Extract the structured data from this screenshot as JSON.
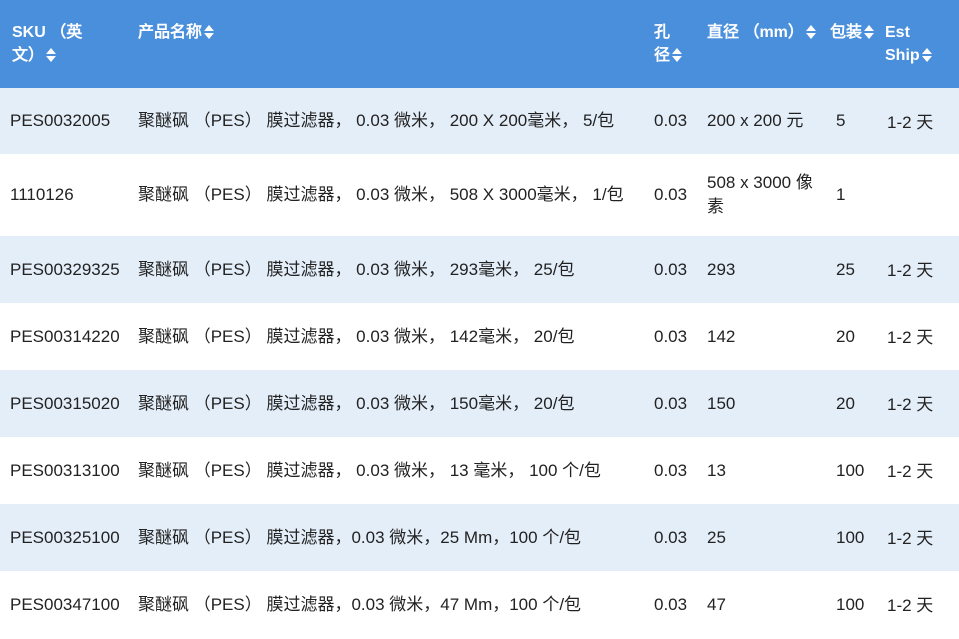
{
  "headers": {
    "sku": "SKU （英文）",
    "name": "产品名称",
    "pore": "孔径",
    "diameter": "直径 （mm）",
    "pack": "包装",
    "ship": "Est Ship"
  },
  "rows": [
    {
      "sku": "PES0032005",
      "name": "聚醚砜 （PES） 膜过滤器， 0.03 微米， 200 X 200毫米， 5/包",
      "pore": "0.03",
      "diameter": "200 x 200 元",
      "pack": "5",
      "ship": "1-2 天"
    },
    {
      "sku": "1110126",
      "name": "聚醚砜 （PES） 膜过滤器， 0.03 微米， 508 X 3000毫米， 1/包",
      "pore": "0.03",
      "diameter": "508 x 3000 像素",
      "pack": "1",
      "ship": ""
    },
    {
      "sku": "PES00329325",
      "name": "聚醚砜 （PES） 膜过滤器， 0.03 微米， 293毫米， 25/包",
      "pore": "0.03",
      "diameter": "293",
      "pack": "25",
      "ship": "1-2 天"
    },
    {
      "sku": "PES00314220",
      "name": "聚醚砜 （PES） 膜过滤器， 0.03 微米， 142毫米， 20/包",
      "pore": "0.03",
      "diameter": "142",
      "pack": "20",
      "ship": "1-2 天"
    },
    {
      "sku": "PES00315020",
      "name": "聚醚砜 （PES） 膜过滤器， 0.03 微米， 150毫米， 20/包",
      "pore": "0.03",
      "diameter": "150",
      "pack": "20",
      "ship": "1-2 天"
    },
    {
      "sku": "PES00313100",
      "name": "聚醚砜 （PES） 膜过滤器， 0.03 微米， 13 毫米， 100 个/包",
      "pore": "0.03",
      "diameter": "13",
      "pack": "100",
      "ship": "1-2 天"
    },
    {
      "sku": "PES00325100",
      "name": "聚醚砜 （PES） 膜过滤器，0.03 微米，25 Mm，100 个/包",
      "pore": "0.03",
      "diameter": "25",
      "pack": "100",
      "ship": "1-2 天"
    },
    {
      "sku": "PES00347100",
      "name": "聚醚砜 （PES） 膜过滤器，0.03 微米，47 Mm，100 个/包",
      "pore": "0.03",
      "diameter": "47",
      "pack": "100",
      "ship": "1-2 天"
    }
  ],
  "colors": {
    "header_bg": "#4a8fdb",
    "row_alt_bg": "#e4eef9",
    "header_text": "#ffffff",
    "body_text": "#222222"
  },
  "icons": {
    "sort": "sort-updown-icon"
  }
}
